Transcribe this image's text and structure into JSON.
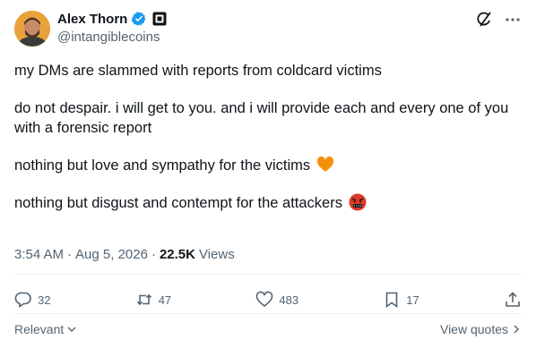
{
  "author": {
    "display_name": "Alex Thorn",
    "handle": "@intangiblecoins"
  },
  "icons": {
    "verified": "verified-badge-icon",
    "affiliate": "affiliate-badge-icon",
    "grok": "grok-icon",
    "more": "more-icon",
    "orange_heart": "orange-heart-emoji",
    "cursing_face": "cursing-face-emoji"
  },
  "tweet": {
    "paragraphs": [
      "my DMs are slammed with reports from coldcard victims",
      "do not despair. i will get to you. and i will provide each and every one of you with a forensic report",
      "nothing but love and sympathy for the victims",
      "nothing but disgust and contempt for the attackers"
    ]
  },
  "meta": {
    "time": "3:54 AM",
    "dot1": "·",
    "date": "Aug 5, 2026",
    "dot2": "·",
    "views_count": "22.5K",
    "views_label": "Views"
  },
  "actions": {
    "replies": "32",
    "reposts": "47",
    "likes": "483",
    "bookmarks": "17"
  },
  "footer": {
    "sort_label": "Relevant",
    "quotes_label": "View quotes"
  },
  "colors": {
    "text": "#0f1419",
    "secondary": "#536471",
    "verified_blue": "#1d9bf0",
    "divider": "#eff3f4"
  }
}
